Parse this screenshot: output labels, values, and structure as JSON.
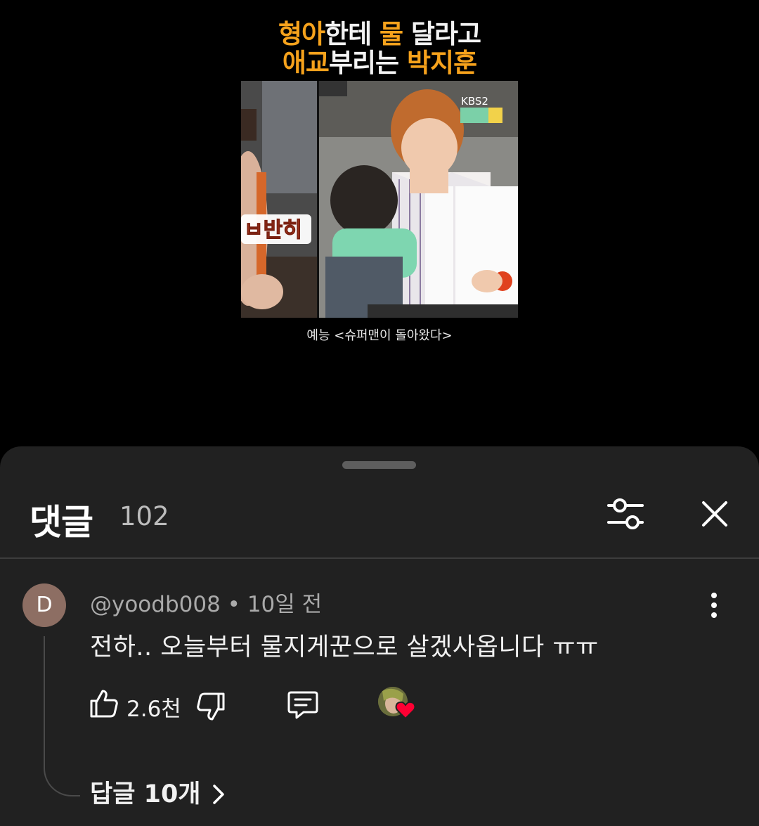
{
  "video": {
    "title_line1": [
      "형아",
      "한테 ",
      "물",
      " 달라고"
    ],
    "title_line2": [
      "애교",
      "부리는 ",
      "박지훈"
    ],
    "overlay_left": "ㅂ반히",
    "channel_logo": "KBS2",
    "caption": "예능 <슈퍼맨이 돌아왔다>"
  },
  "sheet": {
    "title": "댓글",
    "count": "102",
    "filter_icon": "sliders-icon",
    "close_icon": "close-icon"
  },
  "comment": {
    "avatar_letter": "D",
    "author": "@yoodb008",
    "separator": " • ",
    "time": "10일 전",
    "text": "전하.. 오늘부터 물지게꾼으로 살겠사옵니다 ㅠㅠ",
    "likes": "2.6천",
    "replies_label": "답글 10개",
    "colors": {
      "avatar_bg": "#8d6e63",
      "heart": "#ff0033"
    }
  }
}
